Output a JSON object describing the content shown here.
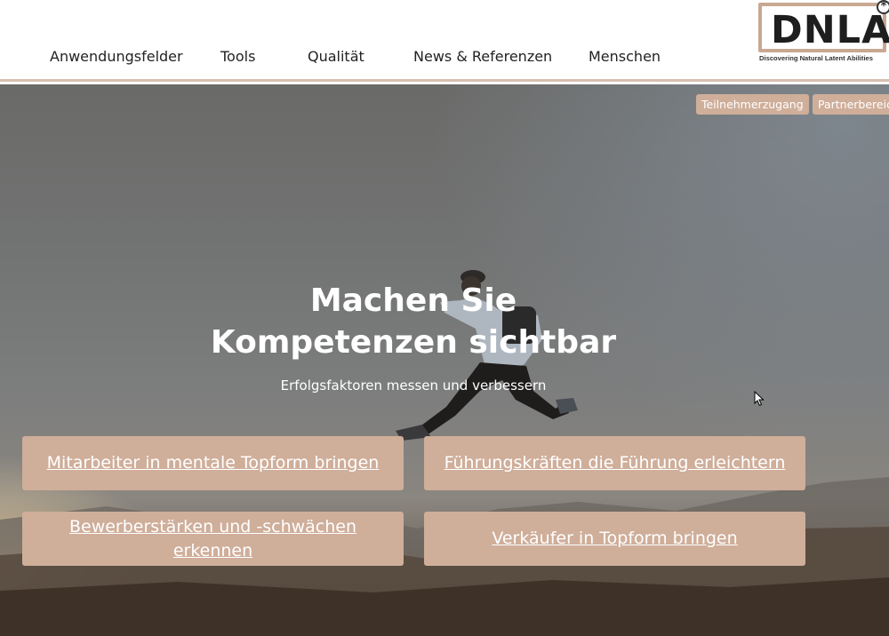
{
  "nav": {
    "items": [
      {
        "label": "Anwendungsfelder"
      },
      {
        "label": "Tools"
      },
      {
        "label": "Qualität"
      },
      {
        "label": "News & Referenzen"
      },
      {
        "label": "Menschen"
      }
    ]
  },
  "logo": {
    "text": "DNLA",
    "mark": "*",
    "tagline": "Discovering Natural Latent Abilities"
  },
  "top_buttons": {
    "teilnehmer": "Teilnehmerzugang",
    "partner": "Partnerbereich"
  },
  "hero": {
    "headline": "Machen Sie Kompetenzen sichtbar",
    "subline": "Erfolgsfaktoren messen und verbessern",
    "image": "runner-jumping-at-sunset"
  },
  "cta": {
    "mitarbeiter": "Mitarbeiter in mentale Topform bringen",
    "fuehrung": "Führungskräften die Führung erleichtern",
    "bewerber": "Bewerberstärken und -schwächen erkennen",
    "verkaeufer": "Verkäufer in Topform bringen"
  },
  "colors": {
    "accent": "#cfae9a",
    "header_border": "#d8bfb0",
    "nav_text": "#222222"
  }
}
